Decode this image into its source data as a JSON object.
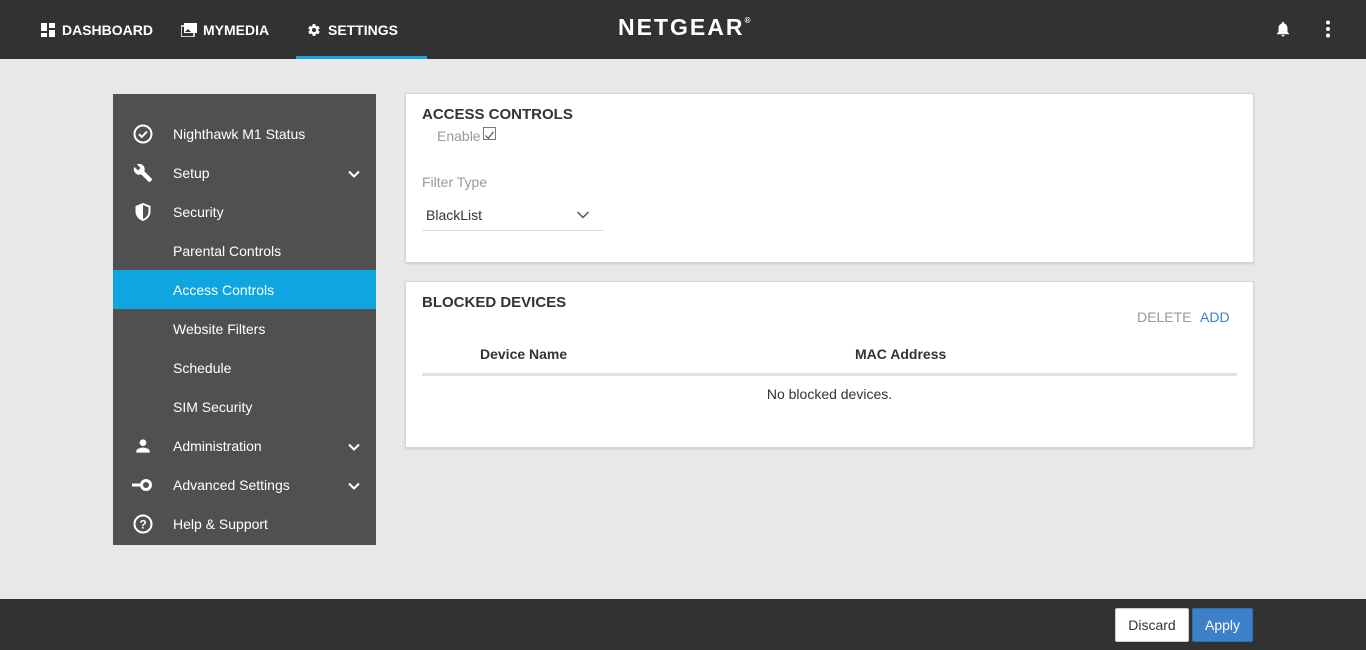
{
  "brand": {
    "logo_text": "NETGEAR",
    "logo_mark": "®"
  },
  "nav": {
    "tabs": [
      {
        "label": "DASHBOARD",
        "icon": "grid-icon"
      },
      {
        "label": "MYMEDIA",
        "icon": "photos-icon"
      },
      {
        "label": "SETTINGS",
        "icon": "gear-icon",
        "active": true
      }
    ],
    "right_icons": [
      "bell-icon",
      "more-vert-icon"
    ]
  },
  "sidebar": {
    "items": [
      {
        "label": "Nighthawk M1 Status",
        "icon": "check-circle-icon"
      },
      {
        "label": "Setup",
        "icon": "wrench-icon",
        "expandable": true
      },
      {
        "label": "Security",
        "icon": "shield-icon"
      },
      {
        "label": "Parental Controls"
      },
      {
        "label": "Access Controls",
        "active": true
      },
      {
        "label": "Website Filters"
      },
      {
        "label": "Schedule"
      },
      {
        "label": "SIM Security"
      },
      {
        "label": "Administration",
        "icon": "person-icon",
        "expandable": true
      },
      {
        "label": "Advanced Settings",
        "icon": "toggle-icon",
        "expandable": true
      },
      {
        "label": "Help & Support",
        "icon": "help-circle-icon"
      }
    ]
  },
  "access_controls": {
    "title": "ACCESS CONTROLS",
    "enable_label": "Enable",
    "enable_checked": true,
    "filter_type_label": "Filter Type",
    "filter_type_value": "BlackList"
  },
  "blocked_devices": {
    "title": "BLOCKED DEVICES",
    "delete_label": "DELETE",
    "add_label": "ADD",
    "columns": [
      "Device Name",
      "MAC Address"
    ],
    "empty_message": "No blocked devices."
  },
  "footer": {
    "discard_label": "Discard",
    "apply_label": "Apply"
  },
  "colors": {
    "accent": "#0ea5e0",
    "topbar": "#323232",
    "sidebar": "#505050",
    "apply": "#3b80c8",
    "link": "#3b80c8",
    "muted": "#999999"
  }
}
